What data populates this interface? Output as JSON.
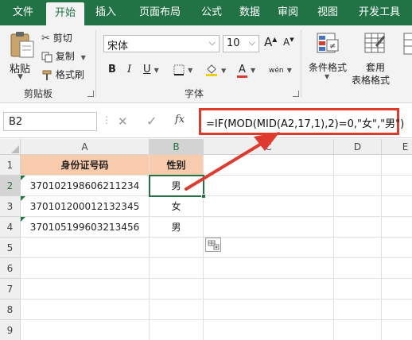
{
  "tabs": [
    "文件",
    "开始",
    "插入",
    "页面布局",
    "公式",
    "数据",
    "审阅",
    "视图",
    "开发工具"
  ],
  "clipboard": {
    "paste_label": "粘贴",
    "cut_label": "剪切",
    "copy_label": "复制",
    "format_painter_label": "格式刷",
    "group_label": "剪贴板"
  },
  "font": {
    "name_value": "宋体",
    "size_value": "10",
    "grow_label": "A",
    "shrink_label": "A",
    "bold_label": "B",
    "italic_label": "I",
    "underline_label": "U",
    "font_color_label": "A",
    "phonetic_label": "wén",
    "group_label": "字体"
  },
  "styles": {
    "conditional_format_label": "条件格式",
    "table_format_label_1": "套用",
    "table_format_label_2": "表格格式"
  },
  "formula_bar": {
    "name_box": "B2",
    "cancel_symbol": "✕",
    "enter_symbol": "✓",
    "fx_symbol": "fx",
    "formula": "=IF(MOD(MID(A2,17,1),2)=0,\"女\",\"男\")"
  },
  "sheet": {
    "columns": [
      "A",
      "B",
      "C",
      "D",
      "E"
    ],
    "rows": [
      "1",
      "2",
      "3",
      "4",
      "5",
      "6",
      "7",
      "8",
      "9"
    ],
    "header": {
      "a": "身份证号码",
      "b": "性别"
    },
    "data": [
      {
        "id": "370102198606211234",
        "gender": "男"
      },
      {
        "id": "370101200012132345",
        "gender": "女"
      },
      {
        "id": "370105199603213456",
        "gender": "男"
      }
    ]
  },
  "colors": {
    "ribbon_green": "#217346",
    "header_fill": "#f8cbad",
    "callout_red": "#e03a2f",
    "font_color_red": "#e03a2f"
  }
}
